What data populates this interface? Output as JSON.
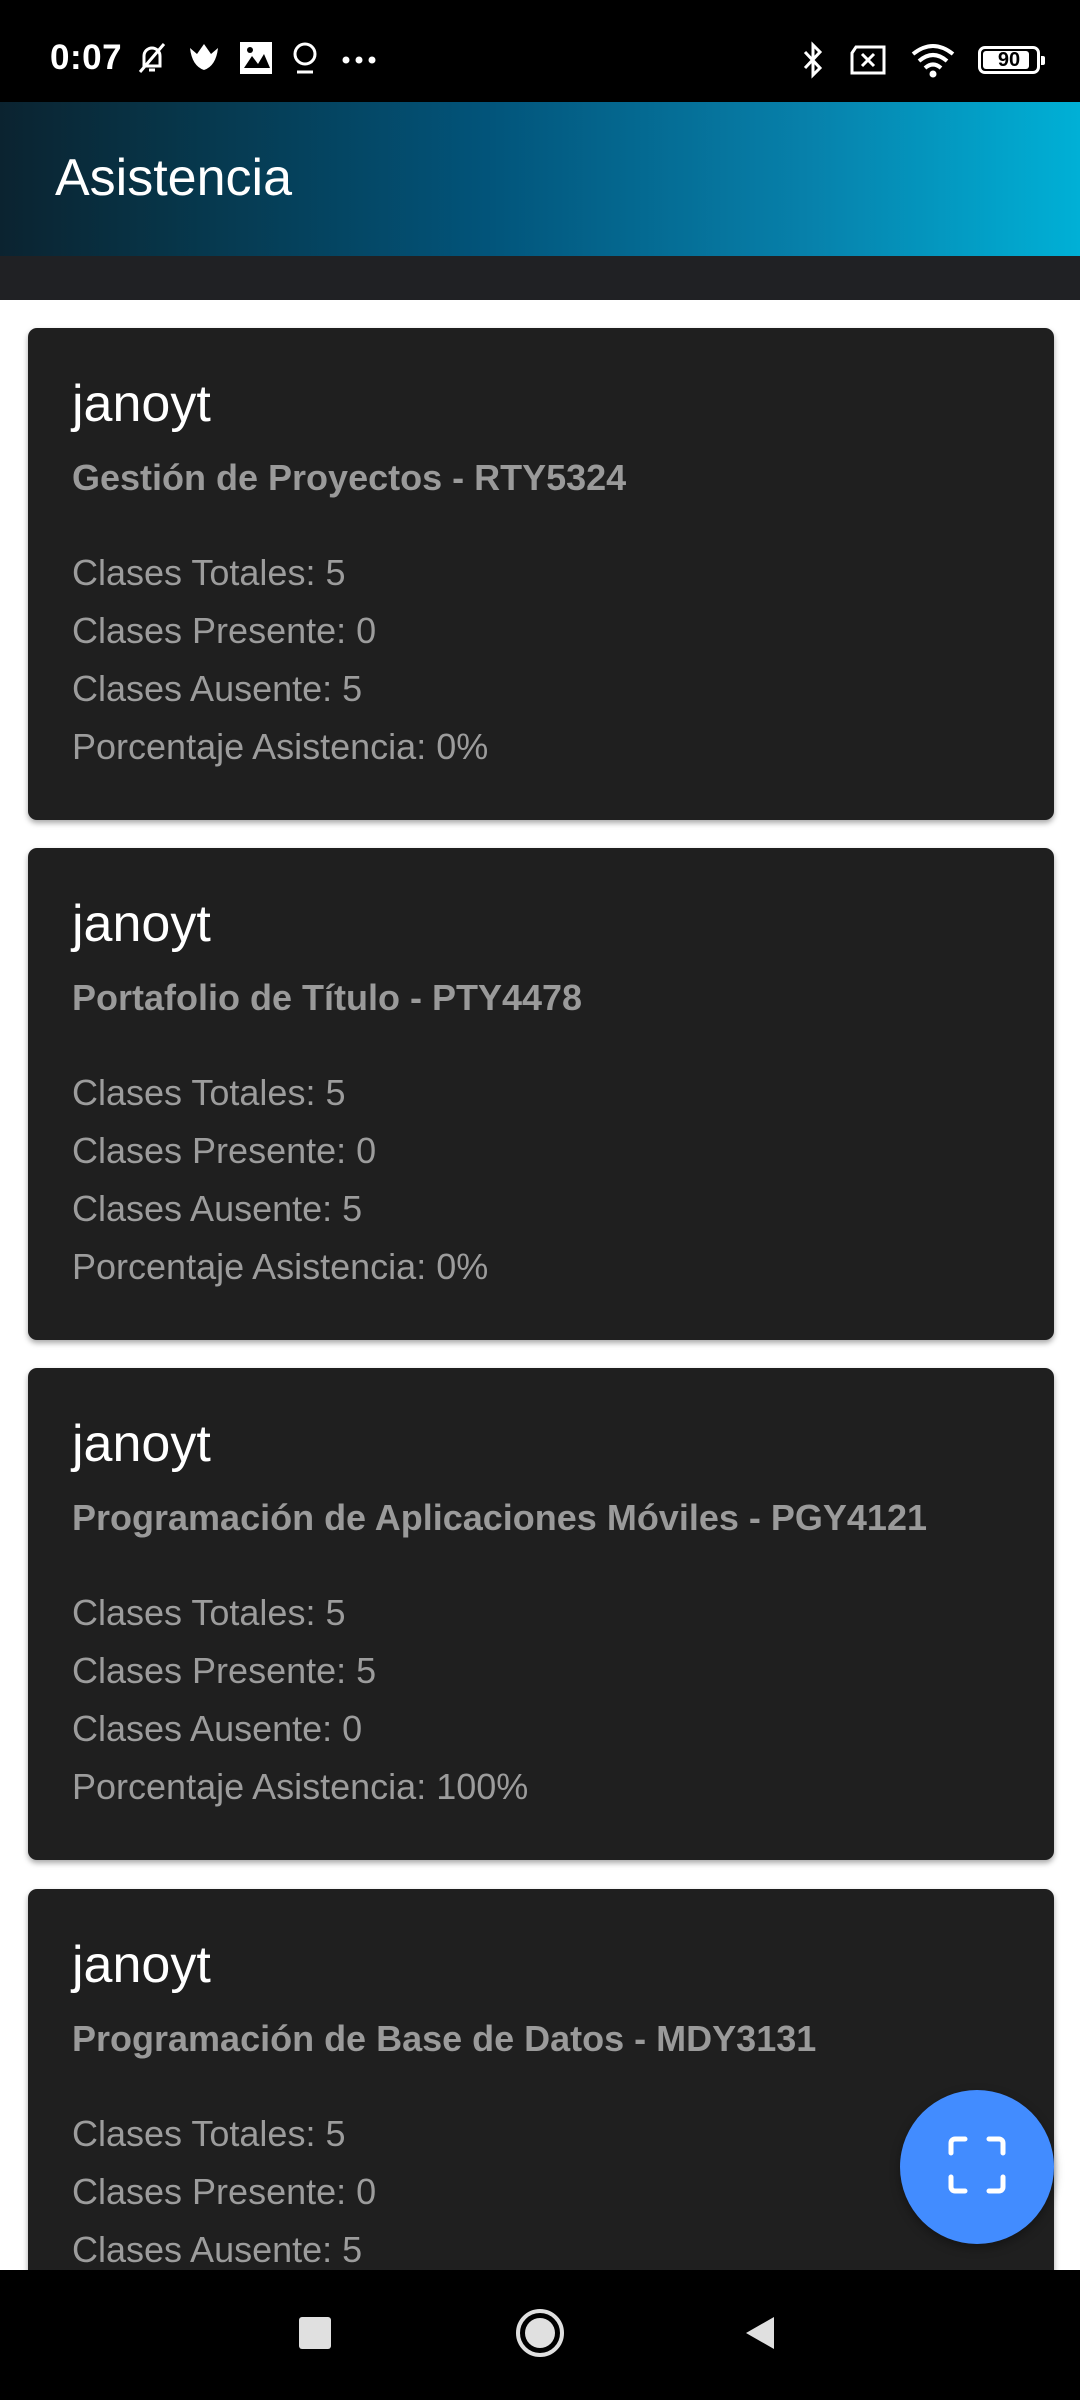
{
  "status_bar": {
    "time": "0:07",
    "battery_level": "90",
    "icons_left": [
      "muted-bell-icon",
      "tulip-icon",
      "photos-icon",
      "location-pin-icon",
      "more-dots-icon"
    ],
    "icons_right": [
      "bluetooth-icon",
      "sim-x-icon",
      "wifi-icon",
      "battery-icon"
    ]
  },
  "header": {
    "title": "Asistencia",
    "colors": {
      "start": "#0b2330",
      "end": "#00b0d6"
    }
  },
  "cards": [
    {
      "title": "janoyt",
      "subtitle": "Gestión de Proyectos - RTY5324",
      "stats": [
        "Clases Totales: 5",
        "Clases Presente: 0",
        "Clases Ausente: 5",
        "Porcentaje Asistencia: 0%"
      ]
    },
    {
      "title": "janoyt",
      "subtitle": "Portafolio de Título - PTY4478",
      "stats": [
        "Clases Totales: 5",
        "Clases Presente: 0",
        "Clases Ausente: 5",
        "Porcentaje Asistencia: 0%"
      ]
    },
    {
      "title": "janoyt",
      "subtitle": "Programación de Aplicaciones Móviles - PGY4121",
      "stats": [
        "Clases Totales: 5",
        "Clases Presente: 5",
        "Clases Ausente: 0",
        "Porcentaje Asistencia: 100%"
      ]
    },
    {
      "title": "janoyt",
      "subtitle": "Programación de Base de Datos - MDY3131",
      "stats": [
        "Clases Totales: 5",
        "Clases Presente: 0",
        "Clases Ausente: 5"
      ]
    }
  ],
  "fab": {
    "icon": "scan-icon",
    "color": "#428cff"
  },
  "nav_bar": {
    "buttons": [
      "recents-square-icon",
      "home-circle-icon",
      "back-triangle-icon"
    ]
  }
}
